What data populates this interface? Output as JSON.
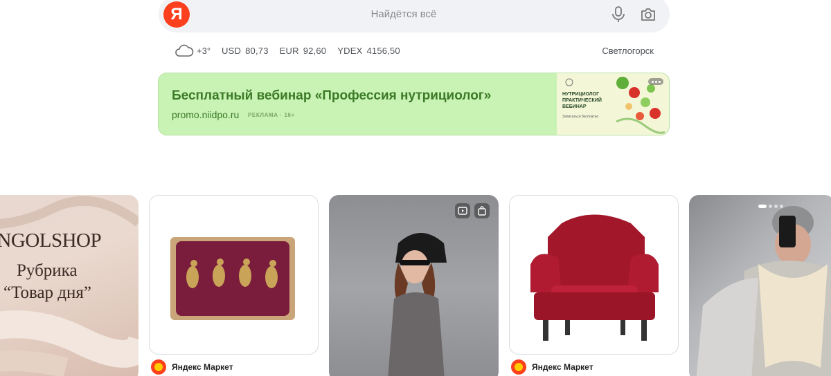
{
  "search": {
    "logo_letter": "Я",
    "placeholder": "Найдётся всё"
  },
  "info": {
    "temperature": "+3°",
    "rates": [
      {
        "name": "USD",
        "value": "80,73"
      },
      {
        "name": "EUR",
        "value": "92,60"
      },
      {
        "name": "YDEX",
        "value": "4156,50"
      }
    ],
    "city": "Светлогорск"
  },
  "ad": {
    "title": "Бесплатный вебинар «Профессия нутрициолог»",
    "domain": "promo.niidpo.ru",
    "label": "РЕКЛАМА · 16+",
    "image_text": "НУТРИЦИОЛОГ ПРАКТИЧЕСКИЙ ВЕБИНАР",
    "image_small": "Записаться бесплатно"
  },
  "cards": {
    "c1": {
      "brand": "ONGOLSHOP",
      "rubric": "Рубрика",
      "product": "“Товар дня”"
    },
    "c2": {
      "source": "Яндекс Маркет"
    },
    "c4": {
      "source": "Яндекс Маркет"
    }
  },
  "colors": {
    "accent": "#fc3f1d",
    "ad_bg": "#c9f2b5",
    "ad_text": "#3b7a26"
  }
}
